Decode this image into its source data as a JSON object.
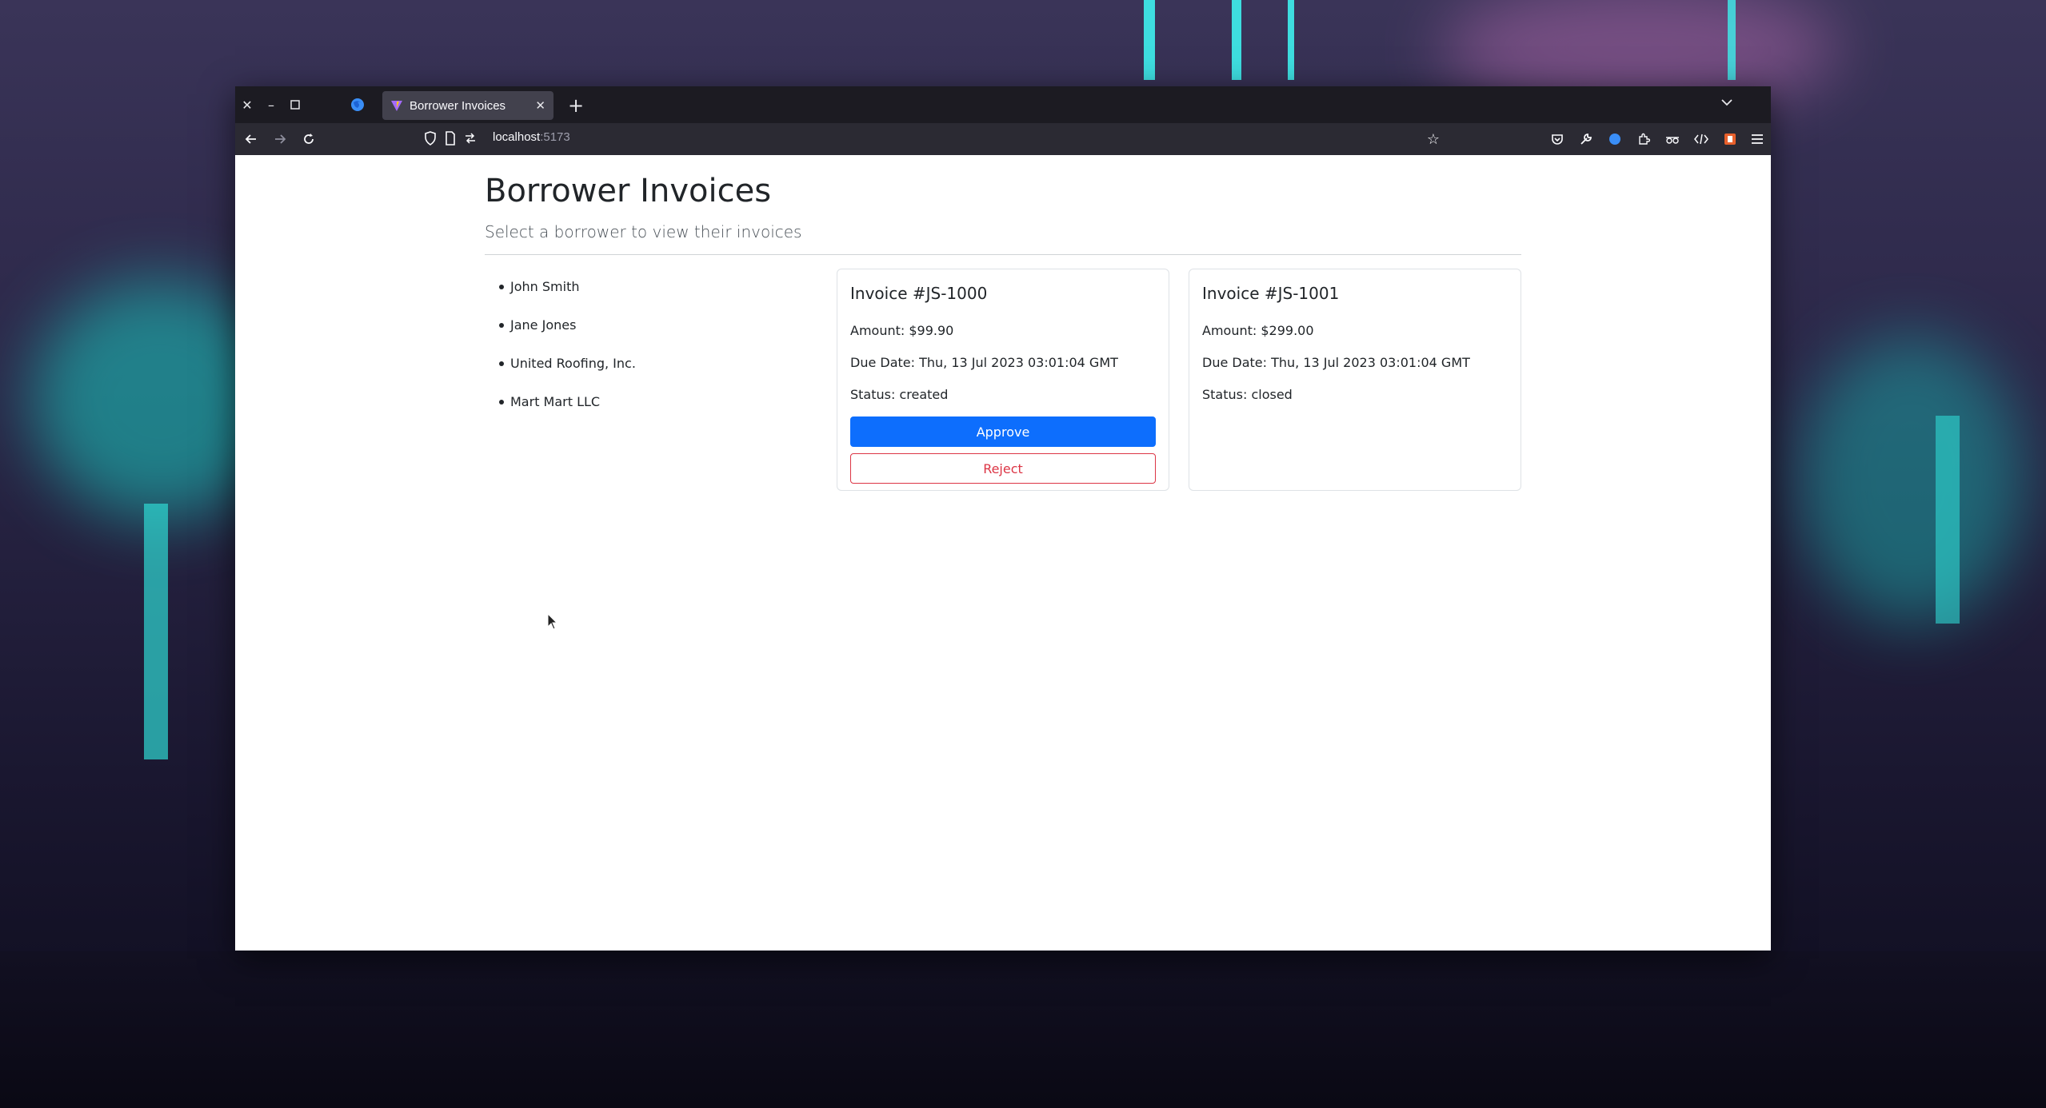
{
  "browser": {
    "tab_title": "Borrower Invoices",
    "url_host": "localhost",
    "url_port": ":5173"
  },
  "page": {
    "title": "Borrower Invoices",
    "subtitle": "Select a borrower to view their invoices"
  },
  "borrowers": [
    {
      "name": "John Smith"
    },
    {
      "name": "Jane Jones"
    },
    {
      "name": "United Roofing, Inc."
    },
    {
      "name": "Mart Mart LLC"
    }
  ],
  "invoices": [
    {
      "title": "Invoice #JS-1000",
      "amount": "Amount: $99.90",
      "due_date": "Due Date: Thu, 13 Jul 2023 03:01:04 GMT",
      "status": "Status: created",
      "approve_label": "Approve",
      "reject_label": "Reject"
    },
    {
      "title": "Invoice #JS-1001",
      "amount": "Amount: $299.00",
      "due_date": "Due Date: Thu, 13 Jul 2023 03:01:04 GMT",
      "status": "Status: closed"
    }
  ],
  "colors": {
    "primary": "#0d6efd",
    "danger": "#dc3545",
    "browser_chrome": "#1c1b22",
    "toolbar": "#2b2a33"
  }
}
